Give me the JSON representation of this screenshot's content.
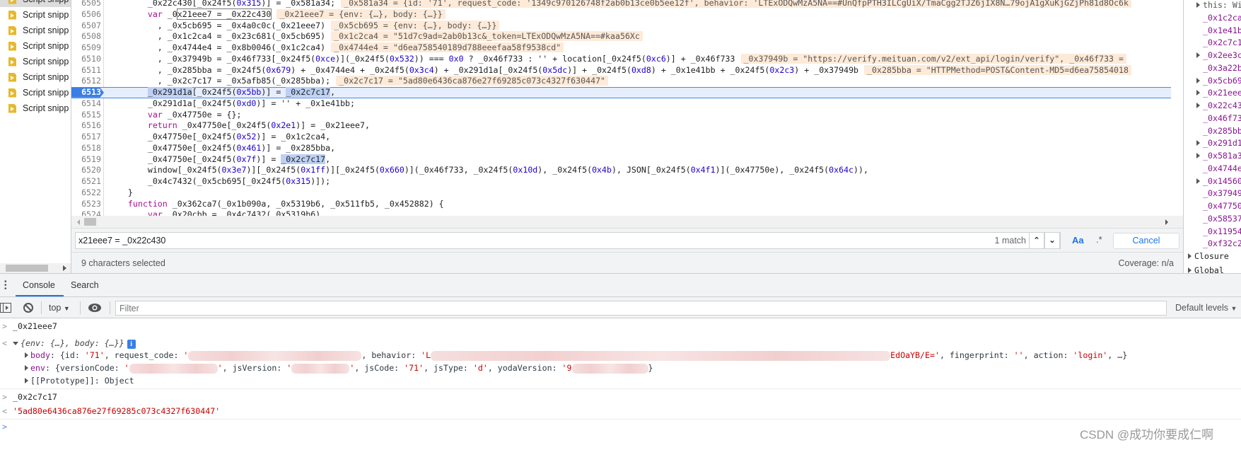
{
  "sidebar": {
    "items": [
      {
        "label": "Script snipp",
        "selected": true
      },
      {
        "label": "Script snipp"
      },
      {
        "label": "Script snipp"
      },
      {
        "label": "Script snipp"
      },
      {
        "label": "Script snipp"
      },
      {
        "label": "Script snipp"
      },
      {
        "label": "Script snipp"
      },
      {
        "label": "Script snipp"
      }
    ],
    "icon": "js-snippet-file-icon"
  },
  "editor": {
    "current_line": 6513,
    "lines": [
      {
        "n": "6505",
        "code": "        _0x22c430[_0x24f5(0x315)] = _0x581a34;",
        "inline": "_0x581a34 = {id: '71', request_code: '1349c970126748f2ab0b13ce0b5ee12f', behavior: 'LTExODQwMzA5NA==#UnQfpPTH3ILCgUiX/TmaCgg2TJZ6jIX8N…79ojA1gXuKjGZjPh81d8Oc6k"
      },
      {
        "n": "6506",
        "code": "        var _0x21eee7 = _0x22c430",
        "inline": "_0x21eee7 = {env: {…}, body: {…}}",
        "marks": [
          {
            "text": "x21eee7 = _0x22c430",
            "kind": "match"
          }
        ]
      },
      {
        "n": "6507",
        "code": "          , _0x5cb695 = _0x4a0c0c(_0x21eee7)",
        "inline": "_0x5cb695 = {env: {…}, body: {…}}"
      },
      {
        "n": "6508",
        "code": "          , _0x1c2ca4 = _0x23c681(_0x5cb695)",
        "inline": "_0x1c2ca4 = \"51d7c9ad=2ab0b13c&_token=LTExODQwMzA5NA==#kaa56Xc"
      },
      {
        "n": "6509",
        "code": "          , _0x4744e4 = _0x8b0046(_0x1c2ca4)",
        "inline": "_0x4744e4 = \"d6ea758540189d788eeefaa58f9538cd\""
      },
      {
        "n": "6510",
        "code": "          , _0x37949b = _0x46f733[_0x24f5(0xce)](_0x24f5(0x532)) === 0x0 ? _0x46f733 : '' + location[_0x24f5(0xc6)] + _0x46f733",
        "inline": "_0x37949b = \"https://verify.meituan.com/v2/ext_api/login/verify\", _0x46f733 ="
      },
      {
        "n": "6511",
        "code": "          , _0x285bba = _0x24f5(0x679) + _0x4744e4 + _0x24f5(0x3c4) + _0x291d1a[_0x24f5(0x5dc)] + _0x24f5(0xd8) + _0x1e41bb + _0x24f5(0x2c3) + _0x37949b",
        "inline": "_0x285bba = \"HTTPMethod=POST&Content-MD5=d6ea75854018"
      },
      {
        "n": "6512",
        "code": "          , _0x2c7c17 = _0x5afb85(_0x285bba);",
        "inline": "_0x2c7c17 = \"5ad80e6436ca876e27f69285c073c4327f630447\""
      },
      {
        "n": "6513",
        "code": "        _0x291d1a[_0x24f5(0x5bb)] = _0x2c7c17,",
        "marks": [
          {
            "text": "_0x291d1a",
            "kind": "sel"
          },
          {
            "text": "_0x2c7c17",
            "kind": "sel"
          }
        ]
      },
      {
        "n": "6514",
        "code": "        _0x291d1a[_0x24f5(0xd0)] = '' + _0x1e41bb;"
      },
      {
        "n": "6515",
        "code": "        var _0x47750e = {};"
      },
      {
        "n": "6516",
        "code": "        return _0x47750e[_0x24f5(0x2e1)] = _0x21eee7,"
      },
      {
        "n": "6517",
        "code": "        _0x47750e[_0x24f5(0x52)] = _0x1c2ca4,"
      },
      {
        "n": "6518",
        "code": "        _0x47750e[_0x24f5(0x461)] = _0x285bba,"
      },
      {
        "n": "6519",
        "code": "        _0x47750e[_0x24f5(0x7f)] = _0x2c7c17,",
        "marks": [
          {
            "text": "_0x2c7c17",
            "kind": "sel"
          }
        ]
      },
      {
        "n": "6520",
        "code": "        window[_0x24f5(0x3e7)][_0x24f5(0x1ff)][_0x24f5(0x660)](_0x46f733, _0x24f5(0x10d), _0x24f5(0x4b), JSON[_0x24f5(0x4f1)](_0x47750e), _0x24f5(0x64c)),"
      },
      {
        "n": "6521",
        "code": "        _0x4c7432(_0x5cb695[_0x24f5(0x315)]);"
      },
      {
        "n": "6522",
        "code": "    }"
      },
      {
        "n": "6523",
        "code": "    function _0x362ca7(_0x1b090a, _0x5319b6, _0x511fb5, _0x452882) {"
      },
      {
        "n": "6524",
        "code": "        var _0x20cbb = _0x4c7432(_0x5319b6)"
      }
    ]
  },
  "search": {
    "query": "x21eee7 = _0x22c430",
    "match_count": "1 match",
    "case_label": "Aa",
    "regex_label": ".*",
    "cancel_label": "Cancel"
  },
  "status": {
    "selection": "9 characters selected",
    "coverage": "Coverage: n/a"
  },
  "scope": {
    "items": [
      {
        "name": "this: Wi",
        "expandable": true
      },
      {
        "name": "_0x1c2ca"
      },
      {
        "name": "_0x1e41b"
      },
      {
        "name": "_0x2c7c1"
      },
      {
        "name": "_0x2ee3c",
        "expandable": true
      },
      {
        "name": "_0x3a22b"
      },
      {
        "name": "_0x5cb69",
        "expandable": true
      },
      {
        "name": "_0x21eee",
        "expandable": true
      },
      {
        "name": "_0x22c43",
        "expandable": true
      },
      {
        "name": "_0x46f73"
      },
      {
        "name": "_0x285bb"
      },
      {
        "name": "_0x291d1",
        "expandable": true
      },
      {
        "name": "_0x581a3",
        "expandable": true
      },
      {
        "name": "_0x4744e"
      },
      {
        "name": "_0x14560",
        "expandable": true
      },
      {
        "name": "_0x37949"
      },
      {
        "name": "_0x47750"
      },
      {
        "name": "_0x58537"
      },
      {
        "name": "_0x11954"
      },
      {
        "name": "_0xf32c2"
      }
    ],
    "closure": "Closure",
    "global": "Global"
  },
  "drawer": {
    "tabs": [
      "Console",
      "Search"
    ],
    "active_tab": "Console"
  },
  "console_toolbar": {
    "context": "top",
    "filter_placeholder": "Filter",
    "levels": "Default levels"
  },
  "console": {
    "input1": "_0x21eee7",
    "obj_preview": "{env: {…}, body: {…}}",
    "body": {
      "key": "body",
      "p1": ": {id: ",
      "id": "'71'",
      "p2": ", request_code: ",
      "q": "'",
      "p3": ", behavior: ",
      "behavior_start": "'L",
      "behavior_end": "EdOaYB/E='",
      "p4": ", fingerprint: ",
      "fingerprint": "''",
      "p5": ", action: ",
      "action": "'login'",
      "p6": ", …}"
    },
    "env": {
      "key": "env",
      "p1": ": {versionCode: ",
      "q": "'",
      "p2": ", jsVersion: ",
      "p3": ", jsCode: ",
      "jsCode": "'71'",
      "p4": ", jsType: ",
      "jsType": "'d'",
      "p5": ", yodaVersion: ",
      "yoda_start": "'9",
      "p6": "}"
    },
    "prototype": "[[Prototype]]: Object",
    "input2": "_0x2c7c17",
    "result2": "'5ad80e6436ca876e27f69285c073c4327f630447'"
  },
  "watermark": "CSDN @成功你要成仁啊",
  "colors": {
    "accent": "#1a73e8",
    "keyword": "#aa0d91",
    "number": "#1c00cf",
    "string": "#c80000",
    "property": "#881391",
    "inline_value_bg": "#feead8"
  }
}
